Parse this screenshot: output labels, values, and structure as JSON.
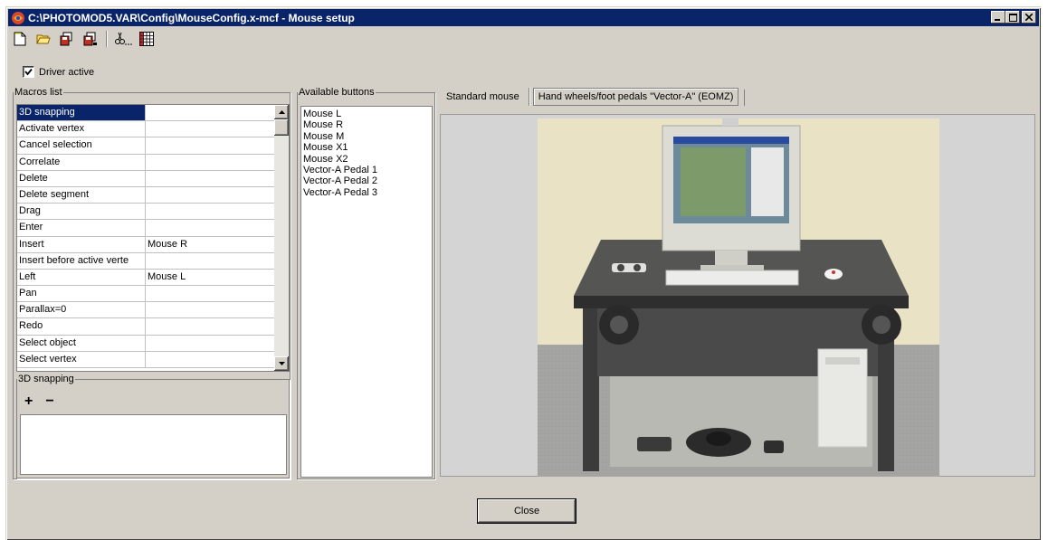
{
  "window": {
    "title": "C:\\PHOTOMOD5.VAR\\Config\\MouseConfig.x-mcf - Mouse setup"
  },
  "title_buttons": {
    "minimize": "_",
    "maximize": "□",
    "close": "×"
  },
  "toolbar": {
    "icons": [
      "new-file-icon",
      "open-folder-icon",
      "save-icon",
      "save-as-icon",
      "scissors-icon",
      "grid-table-icon"
    ]
  },
  "driver": {
    "label": "Driver active",
    "checked": true
  },
  "macros": {
    "group_label": "Macros list",
    "rows": [
      {
        "name": "3D snapping",
        "button": ""
      },
      {
        "name": "Activate vertex",
        "button": ""
      },
      {
        "name": "Cancel selection",
        "button": ""
      },
      {
        "name": "Correlate",
        "button": ""
      },
      {
        "name": "Delete",
        "button": ""
      },
      {
        "name": "Delete segment",
        "button": ""
      },
      {
        "name": "Drag",
        "button": ""
      },
      {
        "name": "Enter",
        "button": ""
      },
      {
        "name": "Insert",
        "button": "Mouse R"
      },
      {
        "name": "Insert before active verte",
        "button": ""
      },
      {
        "name": "Left",
        "button": "Mouse L"
      },
      {
        "name": "Pan",
        "button": ""
      },
      {
        "name": "Parallax=0",
        "button": ""
      },
      {
        "name": "Redo",
        "button": ""
      },
      {
        "name": "Select object",
        "button": ""
      },
      {
        "name": "Select vertex",
        "button": ""
      }
    ]
  },
  "snap": {
    "group_label": "3D snapping",
    "add": "+",
    "remove": "−"
  },
  "available": {
    "group_label": "Available buttons",
    "items": [
      "Mouse L",
      "Mouse R",
      "Mouse M",
      "Mouse X1",
      "Mouse X2",
      "Vector-A Pedal 1",
      "Vector-A Pedal 2",
      "Vector-A Pedal 3"
    ]
  },
  "tabs": [
    {
      "label": "Standard mouse",
      "active": false
    },
    {
      "label": "Hand wheels/foot pedals \"Vector-A\" (EOMZ)",
      "active": true
    }
  ],
  "close_button": {
    "label": "Close"
  },
  "colors": {
    "face": "#d4d0c8",
    "titlebar": "#0a246a",
    "selection": "#0a246a"
  }
}
